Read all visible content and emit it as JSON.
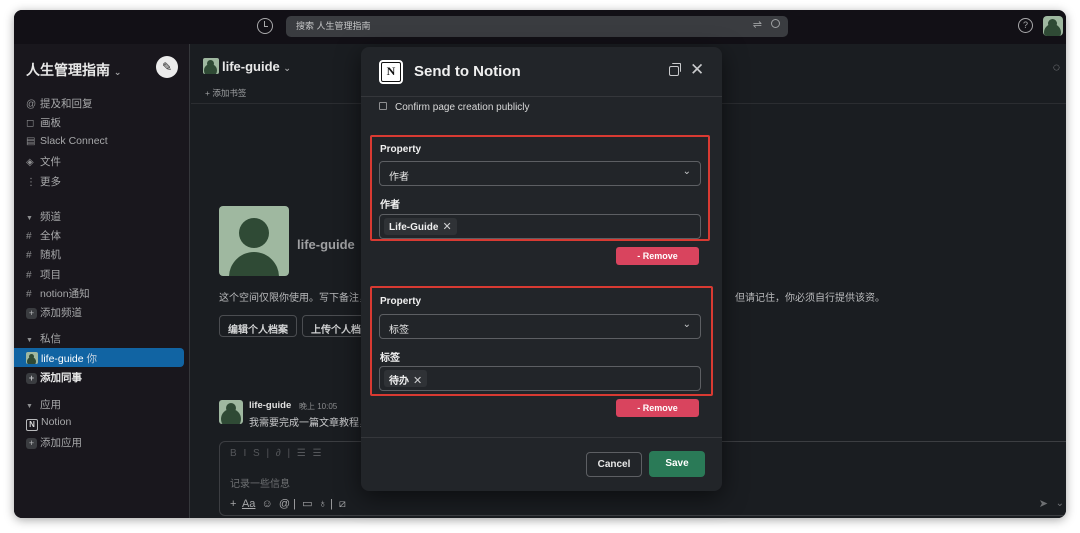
{
  "topbar": {
    "search_placeholder": "搜索 人生管理指南",
    "filter_icon": "filter-icon",
    "search_icon": "search-icon",
    "help_icon": "help-icon"
  },
  "sidebar": {
    "workspace_name": "人生管理指南",
    "nav": [
      {
        "icon": "@",
        "label": "提及和回复"
      },
      {
        "icon": "◻",
        "label": "画板"
      },
      {
        "icon": "▤",
        "label": "Slack Connect"
      },
      {
        "icon": "◈",
        "label": "文件"
      },
      {
        "icon": "⋮",
        "label": "更多"
      }
    ],
    "channels_header": "频道",
    "channels": [
      "全体",
      "随机",
      "项目",
      "notion通知"
    ],
    "add_channel": "添加频道",
    "dm_header": "私信",
    "dm_active": "life-guide",
    "dm_active_suffix": "你",
    "add_coworker": "添加同事",
    "apps_header": "应用",
    "app_notion": "Notion",
    "add_app": "添加应用"
  },
  "main": {
    "channel_name": "life-guide",
    "add_bookmark": "添加书签",
    "intro_name": "life-guide （你",
    "intro_text": "这个空间仅限你使用。写下备注，",
    "intro_tail": "但请记住，你必须自行提供该资。",
    "edit_profile": "编辑个人档案",
    "upload_avatar": "上传个人档案",
    "message": {
      "author": "life-guide",
      "time": "晚上 10:05",
      "text": "我需要完成一篇文章教程，"
    },
    "composer_placeholder": "记录一些信息"
  },
  "modal": {
    "title": "Send to Notion",
    "confirm_label": "Confirm page creation publicly",
    "properties": [
      {
        "label": "Property",
        "selected": "作者",
        "value_label": "作者",
        "chip": "Life-Guide",
        "remove": "- Remove"
      },
      {
        "label": "Property",
        "selected": "标签",
        "value_label": "标签",
        "chip": "待办",
        "remove": "- Remove"
      }
    ],
    "cancel": "Cancel",
    "save": "Save"
  },
  "colors": {
    "accent_active": "#1164a3",
    "save_green": "#2a7a57",
    "remove_red": "#d9445e",
    "highlight_red": "#d93a32"
  }
}
